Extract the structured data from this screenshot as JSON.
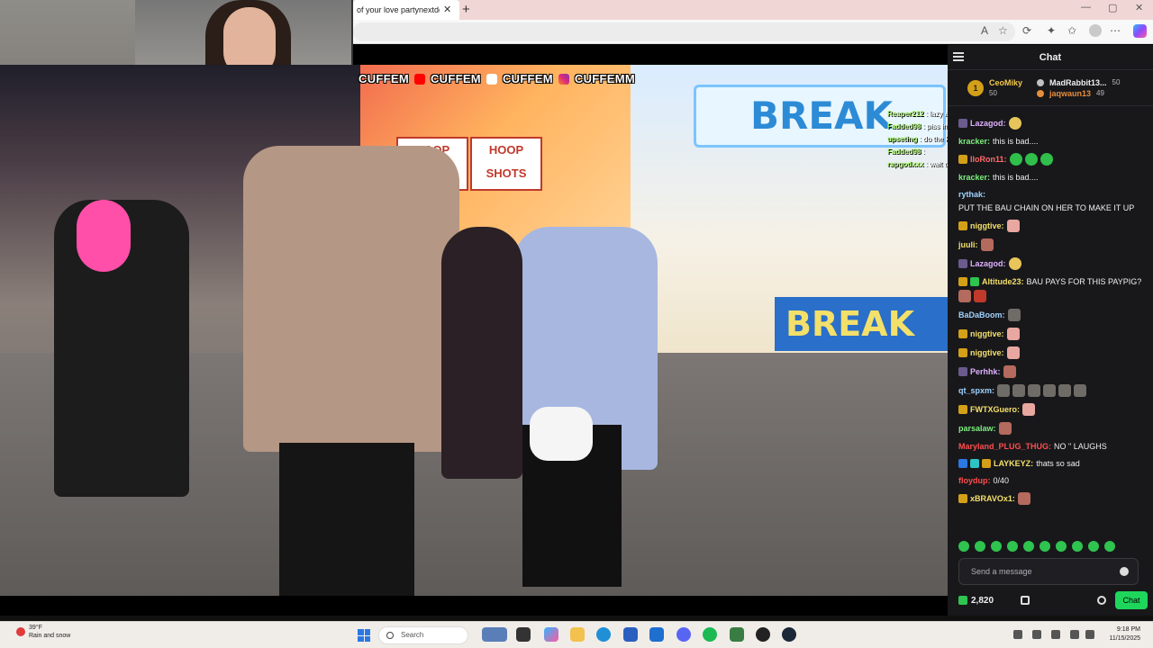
{
  "browser": {
    "tab_title": "of your love partynextdoor",
    "tab_close": "✕",
    "new_tab": "+",
    "win_min": "—",
    "win_max": "▢",
    "win_close": "✕"
  },
  "video": {
    "social_handles": [
      "CUFFEM",
      "CUFFEM",
      "CUFFEM",
      "CUFFEMM"
    ],
    "sign_text": "BREAK",
    "sign_text_2": "BREAK",
    "hoop_text": "HOOP SHOTS",
    "overlay_chat": [
      {
        "user": "Reaper212",
        "text": "lazy ass"
      },
      {
        "user": "Fadded98",
        "text": "piss in a bottle"
      },
      {
        "user": "upseting",
        "text": "do the konvy method pee in bottle"
      },
      {
        "user": "Fadded98",
        "text": ""
      },
      {
        "user": "rapgodxxx",
        "text": "wait dont girls get off to that ?"
      }
    ]
  },
  "chat": {
    "title": "Chat",
    "leaderboard": {
      "first": {
        "rank": "1",
        "name": "CeoMiky",
        "count": "50"
      },
      "second": {
        "name": "MadRabbit13...",
        "count": "50"
      },
      "third": {
        "name": "jaqwaun13",
        "count": "49"
      }
    },
    "messages": [
      {
        "user": "Lazagod:",
        "text": "",
        "color": "#e0b0ff"
      },
      {
        "user": "kracker:",
        "text": "this is bad....",
        "color": "#7df07d"
      },
      {
        "user": "lloRon11:",
        "text": "",
        "color": "#ff6b6b"
      },
      {
        "user": "kracker:",
        "text": "this is bad....",
        "color": "#7df07d"
      },
      {
        "user": "rythak:",
        "text": "PUT THE BAU CHAIN ON HER TO MAKE IT UP",
        "color": "#9fd3ff"
      },
      {
        "user": "niggtive:",
        "text": "",
        "color": "#f4e06a"
      },
      {
        "user": "juuli:",
        "text": "",
        "color": "#f4e06a"
      },
      {
        "user": "Lazagod:",
        "text": "",
        "color": "#e0b0ff"
      },
      {
        "user": "Altitude23:",
        "text": "BAU PAYS FOR THIS PAYPIG?",
        "color": "#f4e06a"
      },
      {
        "user": "BaDaBoom:",
        "text": "",
        "color": "#9fd3ff"
      },
      {
        "user": "niggtive:",
        "text": "",
        "color": "#f4e06a"
      },
      {
        "user": "niggtive:",
        "text": "",
        "color": "#f4e06a"
      },
      {
        "user": "Perhhk:",
        "text": "",
        "color": "#e0b0ff"
      },
      {
        "user": "qt_spxm:",
        "text": "",
        "color": "#9fd3ff"
      },
      {
        "user": "FWTXGuero:",
        "text": "",
        "color": "#f4e06a"
      },
      {
        "user": "parsalaw:",
        "text": "",
        "color": "#7df07d"
      },
      {
        "user": "Maryland_PLUG_THUG:",
        "text": "NO \" LAUGHS",
        "color": "#ff4d4d"
      },
      {
        "user": "LAYKEYZ:",
        "text": "thats so sad",
        "color": "#f4e06a"
      },
      {
        "user": "floydup:",
        "text": "0/40",
        "color": "#ff4d4d"
      },
      {
        "user": "xBRAVOx1:",
        "text": "",
        "color": "#f4e06a"
      }
    ],
    "input_placeholder": "Send a message",
    "points": "2,820",
    "chat_button": "Chat"
  },
  "taskbar": {
    "temp": "39°F",
    "weather": "Rain and snow",
    "search": "Search",
    "time": "9:18 PM",
    "date": "11/15/2025"
  }
}
